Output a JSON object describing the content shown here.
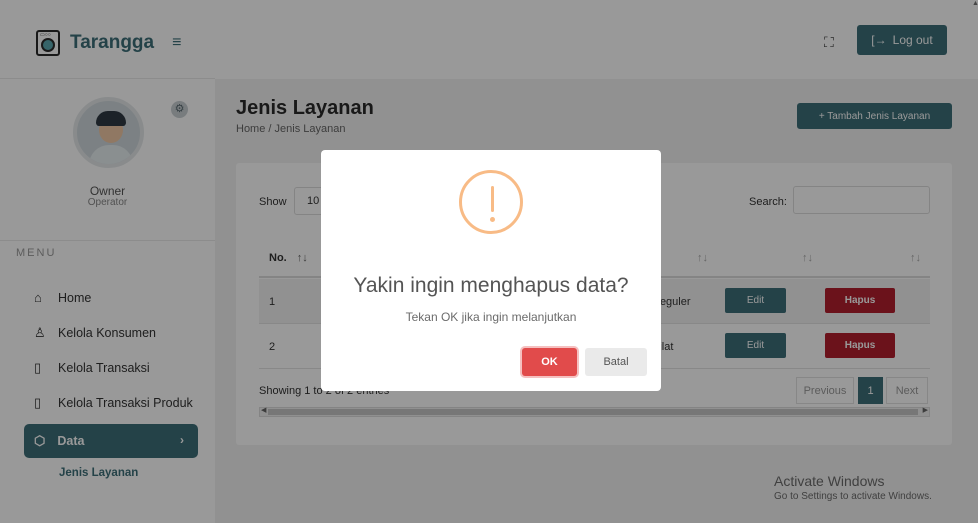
{
  "app": {
    "brand": "Tarangga",
    "menu_toggle_icon": "hamburger-icon"
  },
  "profile": {
    "name": "Owner",
    "role": "Operator",
    "settings_icon": "gear-icon"
  },
  "sidebar": {
    "section_label": "MENU",
    "items": [
      {
        "label": "Home",
        "icon": "home-icon"
      },
      {
        "label": "Kelola Konsumen",
        "icon": "user-icon"
      },
      {
        "label": "Kelola Transaksi",
        "icon": "document-icon"
      },
      {
        "label": "Kelola Transaksi Produk",
        "icon": "document-icon"
      }
    ],
    "active": {
      "label": "Data",
      "icon": "box-icon",
      "chevron": "›"
    },
    "sub_item": "Jenis Layanan"
  },
  "topbar": {
    "fullscreen_icon": "fullscreen-icon",
    "logout_label": "Log out",
    "logout_icon": "logout-icon"
  },
  "page": {
    "title": "Jenis Layanan",
    "breadcrumb": "Home / Jenis Layanan",
    "add_button": "+ Tambah Jenis Layanan"
  },
  "table": {
    "show_label": "Show",
    "show_value": "10",
    "search_label": "Search:",
    "header_no": "No.",
    "sort_icon": "↑↓",
    "rows": [
      {
        "no": "1",
        "name": "Reguler",
        "edit": "Edit",
        "delete": "Hapus"
      },
      {
        "no": "2",
        "name": "Kilat",
        "edit": "Edit",
        "delete": "Hapus"
      }
    ],
    "info": "Showing 1 to 2 of 2 entries",
    "pagination": {
      "previous": "Previous",
      "current": "1",
      "next": "Next"
    }
  },
  "watermark": {
    "line1": "Activate Windows",
    "line2": "Go to Settings to activate Windows."
  },
  "modal": {
    "icon": "warning-icon",
    "title": "Yakin ingin menghapus data?",
    "text": "Tekan OK jika ingin melanjutkan",
    "confirm": "OK",
    "cancel": "Batal",
    "colors": {
      "warning": "#f8bb86",
      "confirm": "#e14b4b"
    }
  },
  "colors": {
    "primary": "#3d6f79",
    "danger": "#b21f2d"
  }
}
